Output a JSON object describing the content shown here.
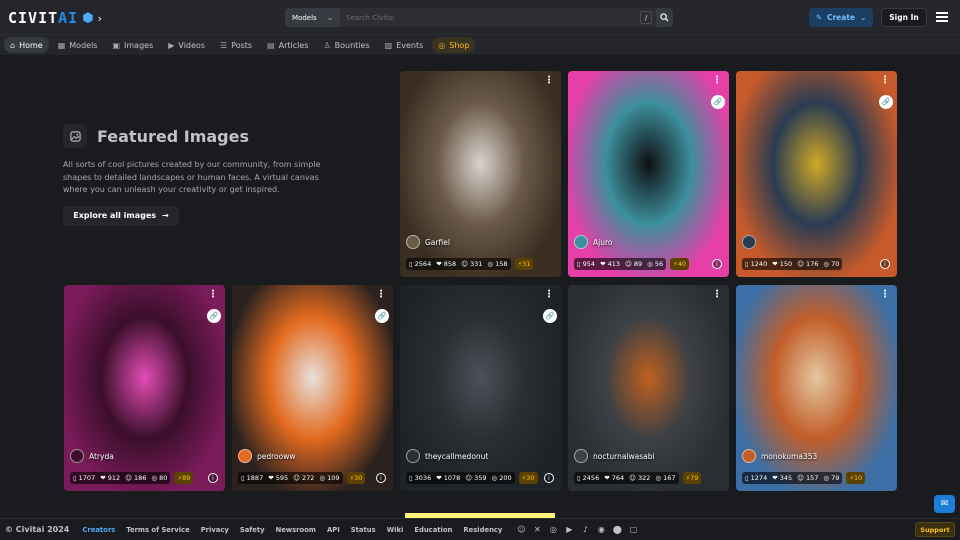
{
  "header": {
    "logo_text_a": "CIVIT",
    "logo_text_b": "AI",
    "search": {
      "model_select": "Models",
      "placeholder": "Search Civitai",
      "shortcut": "/"
    },
    "create_label": "Create",
    "signin_label": "Sign In"
  },
  "nav": [
    {
      "label": "Home",
      "icon": "home-icon",
      "glyph": "⌂",
      "active": true
    },
    {
      "label": "Models",
      "icon": "grid-icon",
      "glyph": "▦"
    },
    {
      "label": "Images",
      "icon": "image-icon",
      "glyph": "▣"
    },
    {
      "label": "Videos",
      "icon": "video-icon",
      "glyph": "▶"
    },
    {
      "label": "Posts",
      "icon": "posts-icon",
      "glyph": "☰"
    },
    {
      "label": "Articles",
      "icon": "article-icon",
      "glyph": "▤"
    },
    {
      "label": "Bounties",
      "icon": "bounty-icon",
      "glyph": "♙"
    },
    {
      "label": "Events",
      "icon": "calendar-icon",
      "glyph": "▧"
    },
    {
      "label": "Shop",
      "icon": "shop-icon",
      "glyph": "◎",
      "shop": true
    }
  ],
  "hero": {
    "title": "Featured Images",
    "description": "All sorts of cool pictures created by our community, from simple shapes to detailed landscapes or human faces. A virtual canvas where you can unleash your creativity or get inspired.",
    "cta": "Explore all images"
  },
  "cards": [
    {
      "user": "Garfiel",
      "views": "2564",
      "likes": "858",
      "laughs": "331",
      "cries": "158",
      "buzz": "31",
      "link": false,
      "info": false,
      "palette": [
        "#3a2e22",
        "#d9d4cf",
        "#6b5a48"
      ]
    },
    {
      "user": "Ajuro",
      "views": "954",
      "likes": "413",
      "laughs": "89",
      "cries": "56",
      "buzz": "40",
      "link": true,
      "info": true,
      "palette": [
        "#e63fa8",
        "#111014",
        "#3c8f9c"
      ]
    },
    {
      "user": "",
      "views": "1240",
      "likes": "150",
      "laughs": "176",
      "cries": "70",
      "buzz": "",
      "link": true,
      "info": true,
      "palette": [
        "#c65a2a",
        "#d0a827",
        "#2a3c52"
      ]
    },
    {
      "user": "Atryda",
      "views": "1707",
      "likes": "912",
      "laughs": "186",
      "cries": "80",
      "buzz": "89",
      "link": true,
      "info": true,
      "palette": [
        "#7a1b5a",
        "#e34db5",
        "#3b0f2b"
      ]
    },
    {
      "user": "pedrooww",
      "views": "1887",
      "likes": "595",
      "laughs": "272",
      "cries": "109",
      "buzz": "30",
      "link": true,
      "info": true,
      "palette": [
        "#2b2220",
        "#e8e0dc",
        "#e36a1f"
      ]
    },
    {
      "user": "theycallmedonut",
      "views": "3036",
      "likes": "1078",
      "laughs": "359",
      "cries": "200",
      "buzz": "30",
      "link": true,
      "info": true,
      "palette": [
        "#1f2327",
        "#4b5259",
        "#2b2f33"
      ]
    },
    {
      "user": "nocturnalwasabi",
      "views": "2456",
      "likes": "764",
      "laughs": "322",
      "cries": "167",
      "buzz": "79",
      "link": false,
      "info": false,
      "palette": [
        "#2a2d31",
        "#c0601f",
        "#3d4044"
      ]
    },
    {
      "user": "monokuma353",
      "views": "1274",
      "likes": "345",
      "laughs": "157",
      "cries": "79",
      "buzz": "10",
      "link": false,
      "info": false,
      "palette": [
        "#3b6fa6",
        "#e4c7a0",
        "#c25e2a"
      ]
    }
  ],
  "footer": {
    "copyright": "© Civitai 2024",
    "links": [
      "Creators",
      "Terms of Service",
      "Privacy",
      "Safety",
      "Newsroom",
      "API",
      "Status",
      "Wiki",
      "Education",
      "Residency"
    ],
    "social": [
      "discord-icon",
      "x-icon",
      "instagram-icon",
      "youtube-icon",
      "tiktok-icon",
      "reddit-icon",
      "github-icon",
      "twitch-icon"
    ],
    "support": "Support"
  }
}
